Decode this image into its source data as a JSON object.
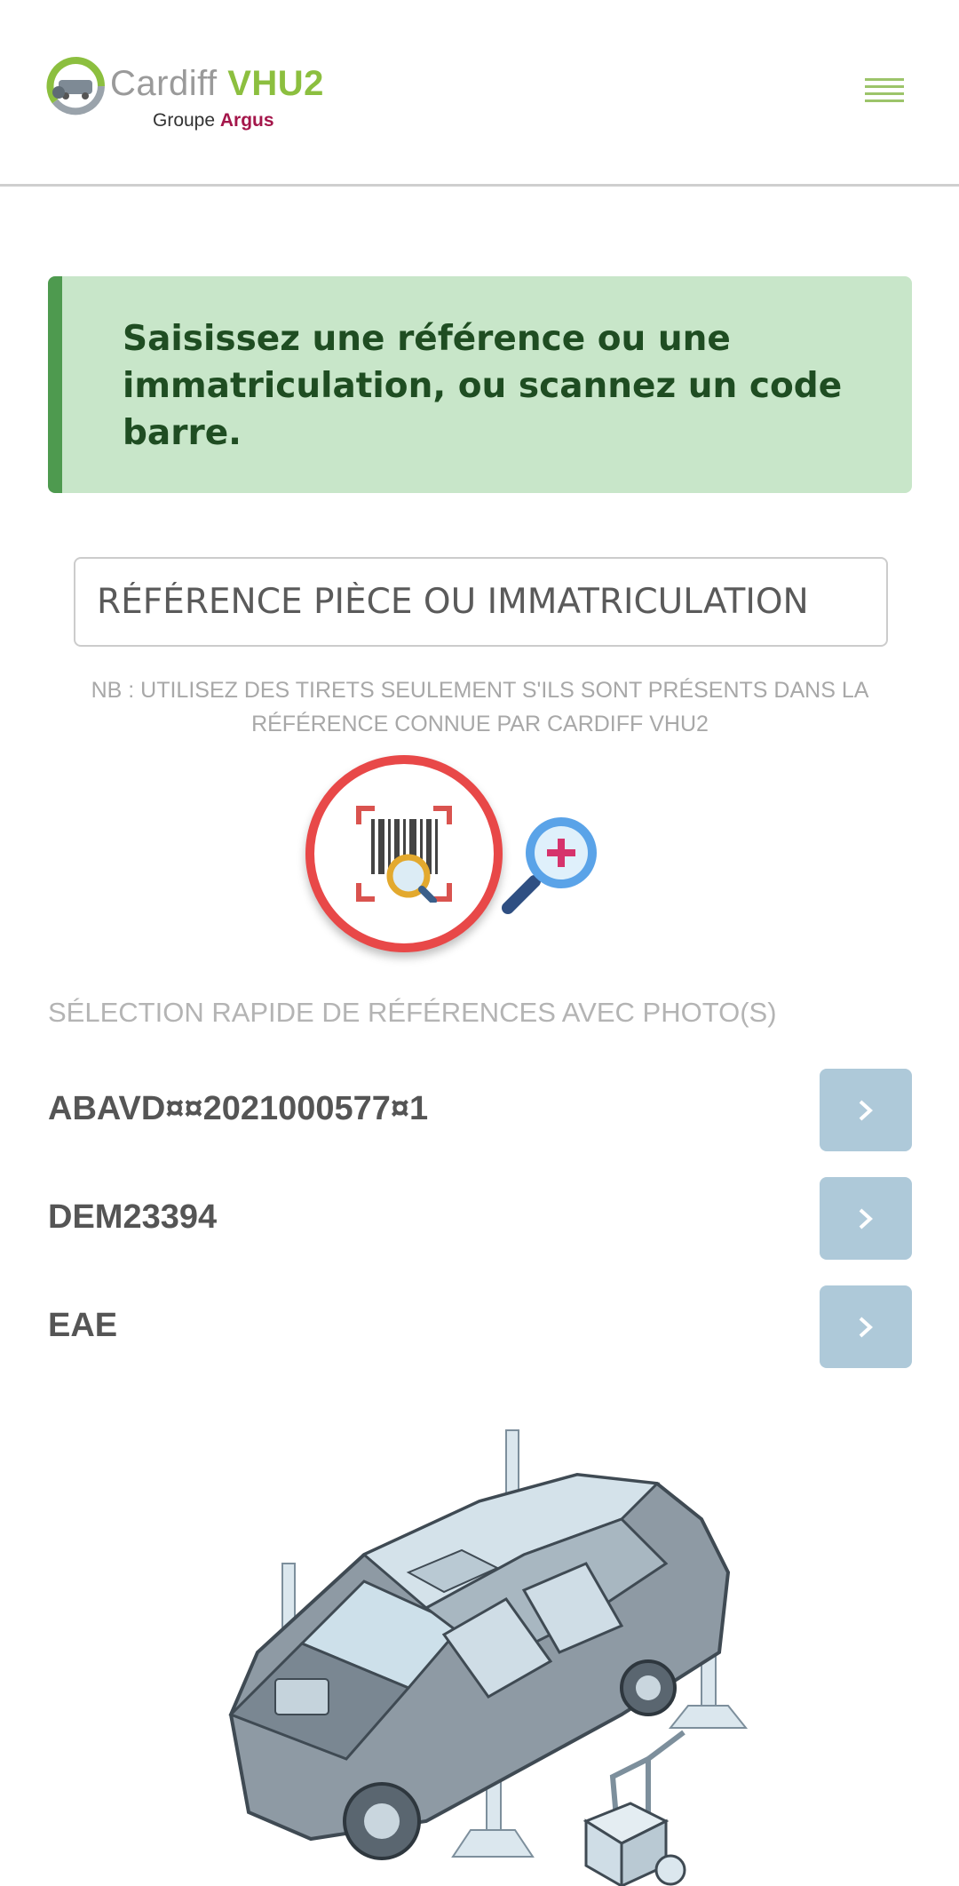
{
  "header": {
    "brand_name": "Cardiff ",
    "brand_accent": "VHU2",
    "brand_sub": "Groupe ",
    "brand_sub_accent": "Argus",
    "menu_icon": "hamburger-menu-icon"
  },
  "banner": {
    "text": "Saisissez une référence ou une immatriculation, ou scannez un code barre."
  },
  "search": {
    "placeholder": "RÉFÉRENCE PIÈCE OU IMMATRICULATION",
    "value": ""
  },
  "note": "NB : UTILISEZ DES TIRETS SEULEMENT S'ILS SONT PRÉSENTS DANS LA RÉFÉRENCE CONNUE PAR CARDIFF VHU2",
  "actions": {
    "scan_icon": "barcode-scan-icon",
    "zoom_icon": "zoom-in-icon"
  },
  "quick_select": {
    "title": "SÉLECTION RAPIDE DE RÉFÉRENCES AVEC PHOTO(S)",
    "items": [
      {
        "label": "ABAVD¤¤2021000577¤1"
      },
      {
        "label": "DEM23394"
      },
      {
        "label": "EAE"
      }
    ]
  },
  "colors": {
    "accent_green": "#8cbf3f",
    "banner_bg": "#c8e6c9",
    "banner_bar": "#4e9a4f",
    "argus_red": "#a4164a",
    "scan_ring": "#e84848",
    "row_button": "#aec9d9"
  }
}
